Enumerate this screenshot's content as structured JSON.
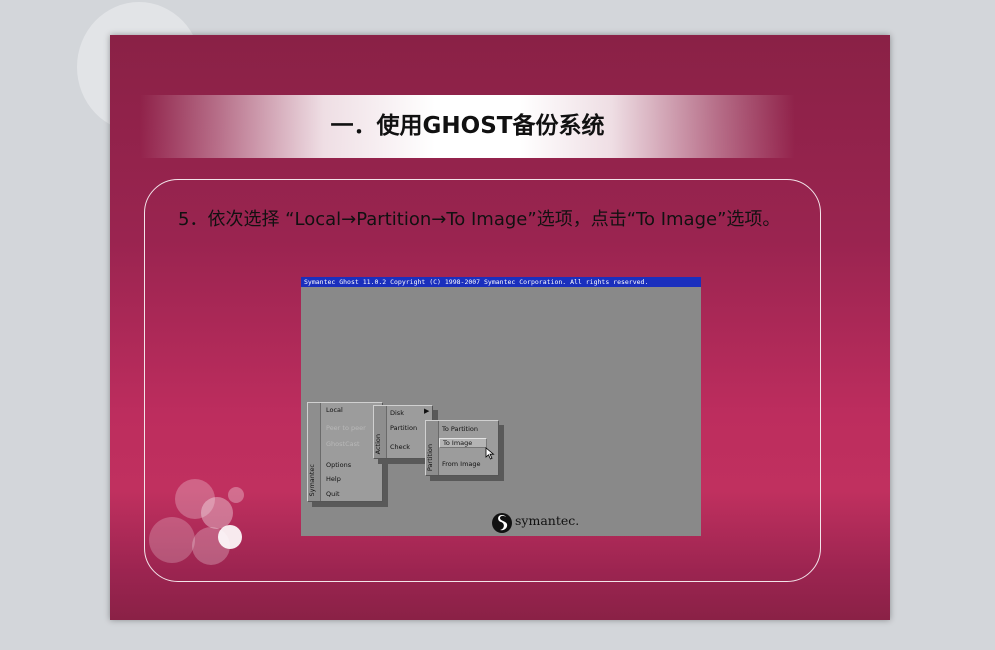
{
  "slide": {
    "title": "一．使用GHOST备份系统",
    "step_text": "5．依次选择 “Local→Partition→To Image”选项，点击“To Image”选项。"
  },
  "ghost_window": {
    "title_bar": "Symantec Ghost 11.0.2   Copyright (C) 1998-2007 Symantec Corporation. All rights reserved.",
    "main_menu": {
      "side_label": "Symantec",
      "items": [
        {
          "label": "Local",
          "enabled": true
        },
        {
          "label": "Peer to peer",
          "enabled": false
        },
        {
          "label": "GhostCast",
          "enabled": false
        },
        {
          "label": "Options",
          "enabled": true
        },
        {
          "label": "Help",
          "enabled": true
        },
        {
          "label": "Quit",
          "enabled": true
        }
      ]
    },
    "action_menu": {
      "side_label": "Action",
      "items": [
        {
          "label": "Disk"
        },
        {
          "label": "Partition"
        },
        {
          "label": "Check"
        }
      ]
    },
    "partition_menu": {
      "side_label": "Partition",
      "items": [
        {
          "label": "To Partition"
        },
        {
          "label": "To Image",
          "selected": true
        },
        {
          "label": "From Image"
        }
      ]
    },
    "brand": "symantec."
  },
  "colors": {
    "slide_bg": "#8a2146",
    "slide_accent": "#c0305f",
    "ghost_bg": "#898989",
    "ghost_titlebar": "#1a2fbd",
    "menu_bg": "#9c9c9c"
  }
}
